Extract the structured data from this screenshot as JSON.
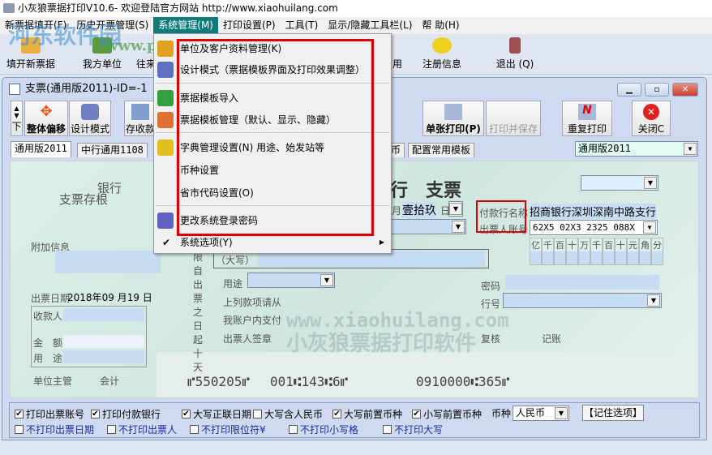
{
  "window": {
    "title": "小灰狼票据打印V10.6- 欢迎登陆官方网站 http://www.xiaohuilang.com"
  },
  "watermark": {
    "site": "河东软件园",
    "url": "www.pc0359.cn"
  },
  "menubar": [
    "新票据填开(F)",
    "历史开票管理(S)",
    "系统管理(M)",
    "打印设置(P)",
    "工具(T)",
    "显示/隐藏工具栏(L)",
    "帮 助(H)"
  ],
  "toolbar": {
    "new": "填开新票据",
    "own": "我方单位",
    "partner": "往来",
    "yong": "用",
    "register": "注册信息",
    "exit": "退出 (Q)"
  },
  "system_menu": {
    "items": [
      "单位及客户资料管理(K)",
      "设计模式（票据模板界面及打印效果调整）",
      "票据模板导入",
      "票据模板管理（默认、显示、隐藏）",
      "字典管理设置(N) 用途、始发站等",
      "币种设置",
      "省市代码设置(O)",
      "更改系统登录密码",
      "系统选项(Y)"
    ]
  },
  "child": {
    "title": "支票(通用版2011)-ID=-1",
    "buttons": {
      "down": "下",
      "offset": "整体偏移",
      "design": "设计模式",
      "save": "存收款",
      "print_single": "单张打印(P)",
      "print_save": "打印并保存",
      "reprint": "重复打印",
      "close": "关闭C"
    },
    "tabs": [
      "通用版2011",
      "中行通用1108",
      "币",
      "配置常用模板"
    ],
    "template_select": "通用版2011"
  },
  "check": {
    "stub_bank": "银行",
    "stub_title": "支票存根",
    "attach": "附加信息",
    "date_label": "出票日期",
    "year": "2018",
    "year_u": "年",
    "month": "09",
    "month_u": "月",
    "day": "19",
    "day_u": "日",
    "payee": "收款人:",
    "amount": "金　额:",
    "usage": "用　途:",
    "supervisor": "单位主管",
    "accountant": "会计",
    "side_text": "限自出票之日起十天",
    "title": "行　支票",
    "day_big": "壹拾玖",
    "day_unit": "日",
    "month_unit": "月",
    "payer_bank_label": "付款行名称",
    "payer_bank": "招商银行深圳深南中路支行",
    "account_label": "出票人账号",
    "account": "62X5 02X3 2325 088X",
    "digits": [
      "亿",
      "千",
      "百",
      "十",
      "万",
      "千",
      "百",
      "十",
      "元",
      "角",
      "分"
    ],
    "rmb_label": "（大写）",
    "usage_label": "用途",
    "pay_from": "上列款项请从",
    "my_account": "我账户内支付",
    "drawer": "出票人签章",
    "password": "密码",
    "bank_no": "行号",
    "review": "复核",
    "book": "记账",
    "wm_url": "www.xiaohuilang.com",
    "wm_name": "小灰狼票据打印软件",
    "micr1": "⑈550205⑈",
    "micr2": "001⑆143⑆6⑈",
    "micr3": "0910000⑆365⑈"
  },
  "options": {
    "row1": [
      {
        "label": "打印出票账号",
        "checked": true
      },
      {
        "label": "打印付款银行",
        "checked": true
      },
      {
        "label": "大写正联日期",
        "checked": true
      },
      {
        "label": "大写含人民币",
        "checked": false
      },
      {
        "label": "大写前置币种",
        "checked": true
      },
      {
        "label": "小写前置币种",
        "checked": true
      }
    ],
    "currency_label": "币种",
    "currency": "人民币",
    "remember": "【记住选项】",
    "row2": [
      {
        "label": "不打印出票日期",
        "checked": false
      },
      {
        "label": "不打印出票人",
        "checked": false
      },
      {
        "label": "不打印限位符¥",
        "checked": false
      },
      {
        "label": "不打印小写格",
        "checked": false
      },
      {
        "label": "不打印大写",
        "checked": false
      }
    ]
  }
}
